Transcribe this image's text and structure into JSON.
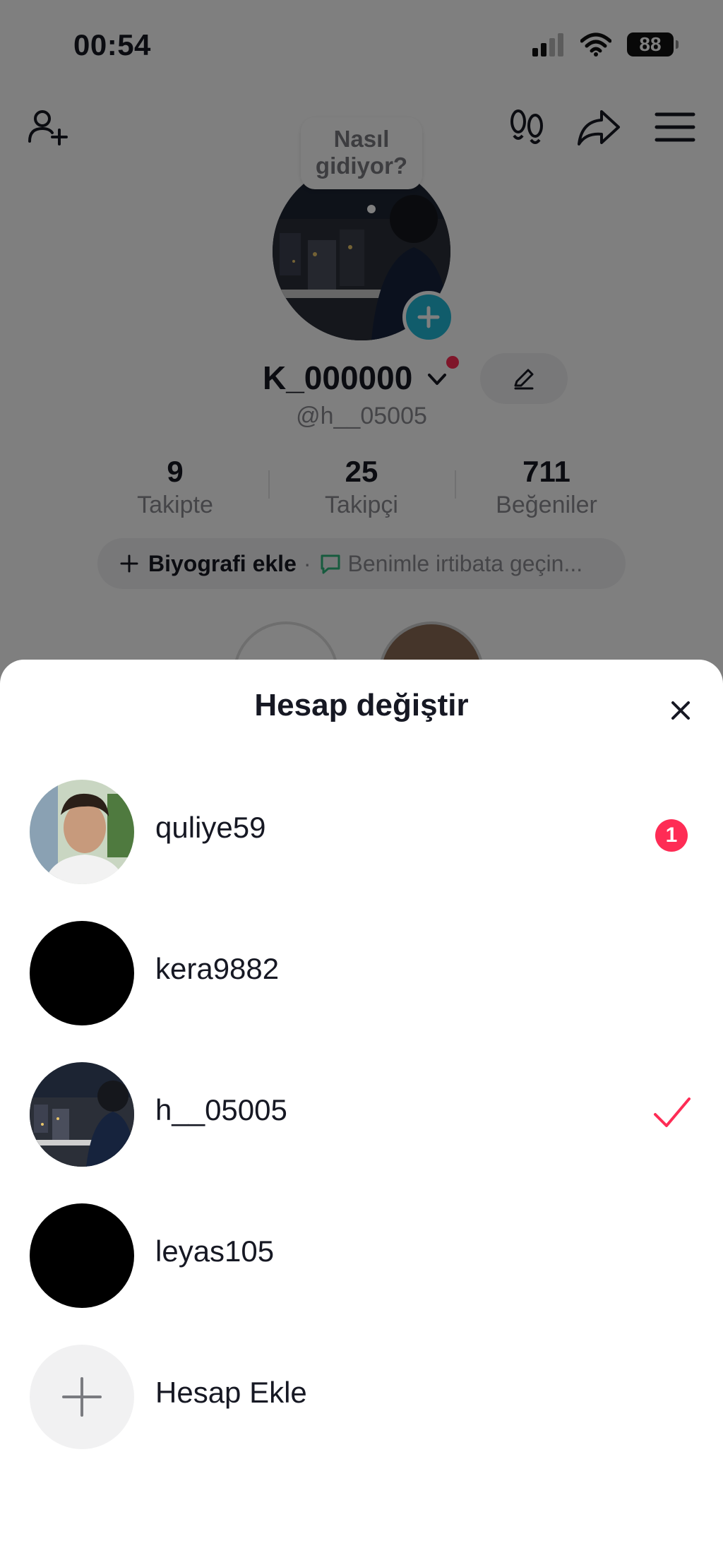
{
  "status_bar": {
    "time": "00:54",
    "battery": "88"
  },
  "profile": {
    "bubble_text_line1": "Nasıl",
    "bubble_text_line2": "gidiyor?",
    "display_name": "K_000000",
    "handle": "@h__05005",
    "stats": [
      {
        "value": "9",
        "label": "Takipte"
      },
      {
        "value": "25",
        "label": "Takipçi"
      },
      {
        "value": "711",
        "label": "Beğeniler"
      }
    ],
    "bio_add": "Biyografi ekle",
    "bio_separator": "·",
    "bio_contact": "Benimle irtibata geçin..."
  },
  "sheet": {
    "title": "Hesap değiştir",
    "accounts": [
      {
        "username": "quliye59",
        "badge": "1"
      },
      {
        "username": "kera9882"
      },
      {
        "username": "h__05005",
        "selected": true
      },
      {
        "username": "leyas105"
      }
    ],
    "add_account_label": "Hesap Ekle"
  },
  "colors": {
    "accent": "#fe2c55",
    "add_badge": "#20b8d6"
  }
}
